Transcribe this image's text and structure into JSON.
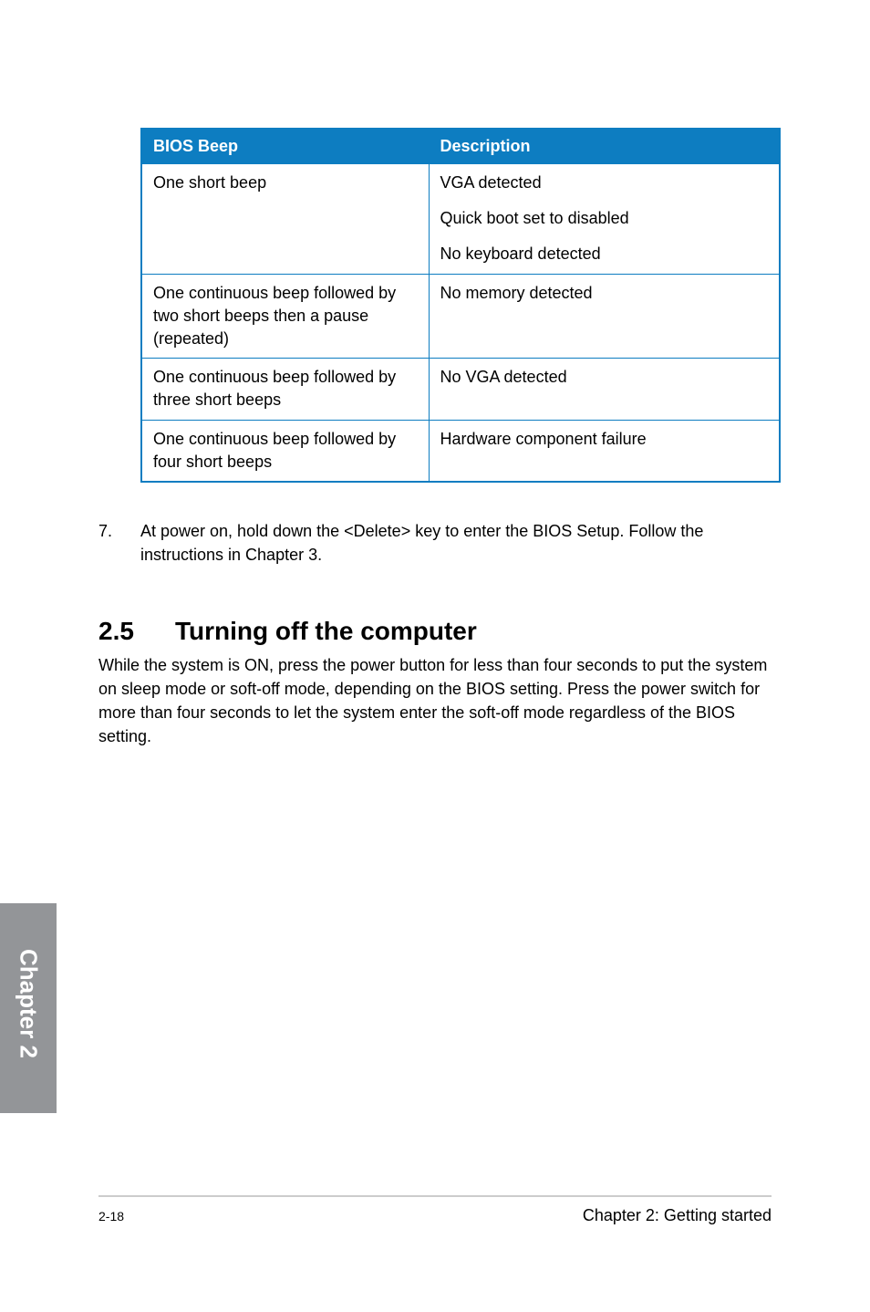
{
  "table": {
    "headers": {
      "col1": "BIOS Beep",
      "col2": "Description"
    },
    "rows": [
      {
        "beep": "One short beep",
        "desc_lines": [
          "VGA detected",
          "Quick boot set to disabled",
          "No keyboard detected"
        ]
      },
      {
        "beep": "One continuous beep followed by two short beeps then a pause (repeated)",
        "desc_lines": [
          "No memory detected"
        ]
      },
      {
        "beep": "One continuous beep followed by three short beeps",
        "desc_lines": [
          "No VGA detected"
        ]
      },
      {
        "beep": "One continuous beep followed by four short beeps",
        "desc_lines": [
          "Hardware component failure"
        ]
      }
    ]
  },
  "step": {
    "number": "7.",
    "text": "At power on, hold down the <Delete> key to enter the BIOS Setup. Follow the instructions in Chapter 3."
  },
  "section": {
    "number": "2.5",
    "title": "Turning off the computer",
    "body": "While the system is ON, press the power button for less than four seconds to put the system on sleep mode or soft-off mode, depending on the BIOS setting. Press the power switch for more than four seconds to let the system enter the soft-off mode regardless of the BIOS setting."
  },
  "chapter_tab": "Chapter 2",
  "footer": {
    "page": "2-18",
    "title": "Chapter 2: Getting started"
  }
}
